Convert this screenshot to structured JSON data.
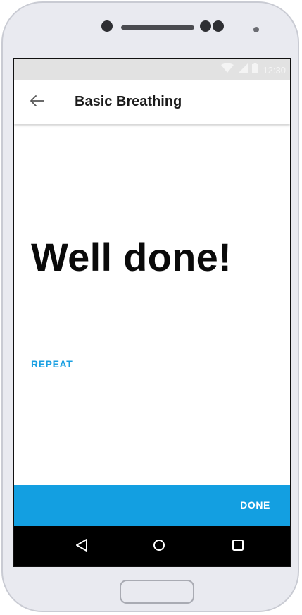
{
  "status_bar": {
    "time": "12:30",
    "icons": [
      "wifi-icon",
      "signal-icon",
      "battery-icon"
    ]
  },
  "app_bar": {
    "back_icon": "arrow-left-icon",
    "title": "Basic Breathing"
  },
  "main": {
    "headline": "Well done!",
    "repeat_label": "REPEAT"
  },
  "bottom_action": {
    "done_label": "DONE"
  },
  "nav_bar": {
    "icons": [
      "back-triangle-icon",
      "home-circle-icon",
      "recents-square-icon"
    ]
  },
  "colors": {
    "accent": "#1ba0e2",
    "action_bar": "#139fe1",
    "status_bar": "#e2e2e2",
    "nav_bar": "#000000",
    "device_body": "#e9eaf0"
  }
}
